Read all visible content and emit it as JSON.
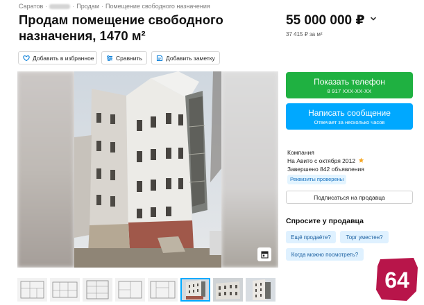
{
  "breadcrumb": {
    "city": "Саратов",
    "category": "Продам",
    "subcategory": "Помещение свободного назначения",
    "separator": "·"
  },
  "title": "Продам помещение свободного назначения, 1470 м²",
  "price": {
    "value": "55 000 000 ₽",
    "per_meter": "37 415 ₽ за м²"
  },
  "actions": {
    "favorite": "Добавить в избранное",
    "compare": "Сравнить",
    "note": "Добавить заметку"
  },
  "contact": {
    "show_phone": "Показать телефон",
    "phone_masked": "8 917 XXX-XX-XX",
    "write_message": "Написать сообщение",
    "reply_time": "Отвечает за несколько часов"
  },
  "seller": {
    "type": "Компания",
    "since": "На Авито с октября 2012",
    "completed": "Завершено 842 объявления",
    "verified": "Реквизиты проверены",
    "subscribe": "Подписаться на продавца"
  },
  "ask": {
    "title": "Спросите у продавца",
    "chips": [
      "Ещё продаёте?",
      "Торг уместен?",
      "Когда можно посмотреть?"
    ]
  },
  "watermark": "64",
  "colors": {
    "green": "#1fb141",
    "blue": "#00a8ff",
    "chip_bg": "#dff1ff",
    "logo": "#b8154a"
  }
}
